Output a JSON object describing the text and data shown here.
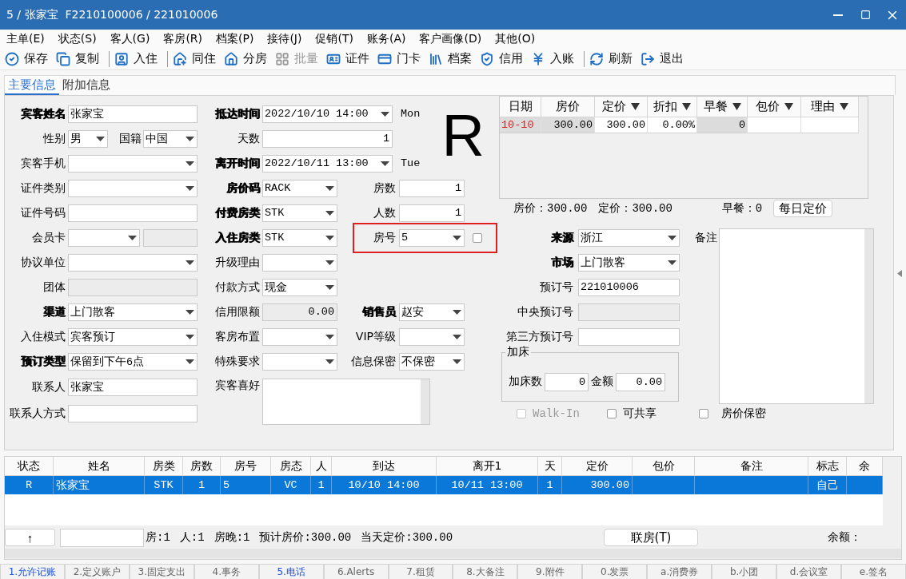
{
  "window": {
    "title": "5 / 张家宝  F2210100006 / 221010006"
  },
  "menu": [
    "主单(E)",
    "状态(S)",
    "客人(G)",
    "客房(R)",
    "档案(P)",
    "接待(J)",
    "促销(T)",
    "账务(A)",
    "客户画像(D)",
    "其他(O)"
  ],
  "toolbar": [
    {
      "label": "保存",
      "disabled": false,
      "separator_before": false
    },
    {
      "label": "复制",
      "disabled": false,
      "separator_before": false
    },
    {
      "label": "入住",
      "disabled": false,
      "separator_before": true
    },
    {
      "label": "同住",
      "disabled": false,
      "separator_before": true
    },
    {
      "label": "分房",
      "disabled": false,
      "separator_before": false
    },
    {
      "label": "批量",
      "disabled": true,
      "separator_before": false
    },
    {
      "label": "证件",
      "disabled": false,
      "separator_before": false
    },
    {
      "label": "门卡",
      "disabled": false,
      "separator_before": false
    },
    {
      "label": "档案",
      "disabled": false,
      "separator_before": false
    },
    {
      "label": "信用",
      "disabled": false,
      "separator_before": false
    },
    {
      "label": "入账",
      "disabled": false,
      "separator_before": false
    },
    {
      "label": "刷新",
      "disabled": false,
      "separator_before": true
    },
    {
      "label": "退出",
      "disabled": false,
      "separator_before": false
    }
  ],
  "tabs": [
    {
      "label": "主要信息",
      "selected": true
    },
    {
      "label": "附加信息",
      "selected": false
    }
  ],
  "status_letter": "R",
  "left_rows": [
    [
      {
        "label": "宾客姓名",
        "value": "张家宝",
        "kind": "text",
        "bold": true
      }
    ],
    [
      {
        "label": "性别",
        "value": "男",
        "kind": "combo",
        "bold": false
      },
      {
        "label": "国籍",
        "value": "中国",
        "kind": "combo",
        "bold": false
      }
    ],
    [
      {
        "label": "宾客手机",
        "kind": "combo",
        "bold": false
      }
    ],
    [
      {
        "label": "证件类别",
        "kind": "combo",
        "bold": false
      }
    ],
    [
      {
        "label": "证件号码",
        "kind": "text",
        "bold": false
      }
    ],
    [
      {
        "label": "会员卡",
        "kind": "combo",
        "bold": false
      },
      {
        "kind": "disabled"
      }
    ],
    [
      {
        "label": "协议单位",
        "kind": "combo",
        "bold": false
      }
    ],
    [
      {
        "label": "团体",
        "kind": "disabled",
        "bold": false
      }
    ],
    [
      {
        "label": "渠道",
        "value": "上门散客",
        "kind": "combo",
        "bold": true
      }
    ],
    [
      {
        "label": "入住模式",
        "value": "宾客预订",
        "kind": "combo",
        "bold": false
      }
    ],
    [
      {
        "label": "预订类型",
        "value": "保留到下午6点",
        "kind": "combo",
        "bold": true
      }
    ],
    [
      {
        "label": "联系人",
        "value": "张家宝",
        "kind": "text",
        "bold": false
      }
    ],
    [
      {
        "label": "联系人方式",
        "kind": "text",
        "bold": false
      }
    ]
  ],
  "middle_fields": [
    {
      "label": "抵达时间",
      "value": "2022/10/10 14:00",
      "kind": "date",
      "bold": true,
      "note": "Mon"
    },
    {
      "label": "天数",
      "value": "1",
      "kind": "number",
      "bold": false
    },
    {
      "label": "离开时间",
      "value": "2022/10/11 13:00",
      "kind": "date",
      "bold": true,
      "note": "Tue"
    },
    {
      "label": "房价码",
      "value": "RACK",
      "kind": "combo",
      "bold": true
    },
    {
      "label": "付费房类",
      "value": "STK",
      "kind": "combo",
      "bold": true
    },
    {
      "label": "入住房类",
      "value": "STK",
      "kind": "combo",
      "bold": true
    },
    {
      "label": "升级理由",
      "kind": "combo",
      "bold": false
    },
    {
      "label": "付款方式",
      "value": "现金",
      "kind": "combo",
      "bold": false
    },
    {
      "label": "信用限额",
      "value": "0.00",
      "kind": "disabled",
      "bold": false
    },
    {
      "label": "客房布置",
      "kind": "combo",
      "bold": false
    },
    {
      "label": "特殊要求",
      "kind": "combo",
      "bold": false
    },
    {
      "label": "宾客喜好",
      "kind": "memo",
      "bold": false
    }
  ],
  "side_fields": [
    {
      "label": "房数",
      "value": "1",
      "kind": "number",
      "bold": false,
      "highlighted": false
    },
    {
      "label": "人数",
      "value": "1",
      "kind": "number",
      "bold": false,
      "highlighted": false
    },
    {
      "label": "房号",
      "value": "5",
      "kind": "combo",
      "bold": false,
      "highlighted": true,
      "checked": false
    },
    {
      "label": "销售员",
      "value": "赵安",
      "kind": "combo",
      "bold": true,
      "highlighted": false
    },
    {
      "label": "VIP等级",
      "kind": "combo",
      "bold": false,
      "highlighted": false
    },
    {
      "label": "信息保密",
      "value": "不保密",
      "kind": "combo",
      "bold": false,
      "highlighted": false
    }
  ],
  "rate_table": {
    "columns": [
      {
        "label": "日期",
        "filter": false,
        "editable": false
      },
      {
        "label": "房价",
        "filter": false,
        "editable": false
      },
      {
        "label": "定价",
        "filter": true,
        "editable": true
      },
      {
        "label": "折扣",
        "filter": true,
        "editable": true
      },
      {
        "label": "早餐",
        "filter": true,
        "editable": false
      },
      {
        "label": "包价",
        "filter": true,
        "editable": true
      },
      {
        "label": "理由",
        "filter": true,
        "editable": true
      }
    ],
    "rows": [
      {
        "cells": [
          "10-10",
          "300.00",
          "300.00",
          "0.00%",
          "0"
        ]
      }
    ]
  },
  "rate_summary": {
    "items": [
      "房价：300.00",
      "定价：300.00",
      "早餐：0"
    ],
    "button": "每日定价"
  },
  "booking_fields": [
    {
      "label": "来源",
      "value": "浙江",
      "kind": "combo",
      "bold": true
    },
    {
      "label": "市场",
      "value": "上门散客",
      "kind": "combo",
      "bold": true
    },
    {
      "label": "预订号",
      "value": "221010006",
      "kind": "text",
      "bold": false
    },
    {
      "label": "中央预订号",
      "kind": "disabled",
      "bold": false
    },
    {
      "label": "第三方预订号",
      "kind": "text",
      "bold": false
    }
  ],
  "remark": {
    "label": "备注"
  },
  "extra_bed": {
    "title": "加床",
    "fields": [
      {
        "label": "加床数",
        "value": "0"
      },
      {
        "label": "金额",
        "value": "0.00"
      }
    ]
  },
  "options": [
    {
      "label": "Walk-In",
      "checked": false,
      "disabled": true
    },
    {
      "label": "可共享",
      "checked": false,
      "disabled": false
    },
    {
      "label": "房价保密",
      "checked": false,
      "disabled": false
    }
  ],
  "room_list": {
    "columns": [
      "状态",
      "姓名",
      "房类",
      "房数",
      "房号",
      "房态",
      "人",
      "到达",
      "离开1",
      "天",
      "定价",
      "包价",
      "备注",
      "标志",
      "余"
    ],
    "rows": [
      {
        "selected": true,
        "cells": [
          "R",
          "张家宝",
          "STK",
          "1",
          "5",
          "VC",
          "1",
          "10/10 14:00",
          "10/11 13:00",
          "1",
          "300.00",
          null,
          null,
          "自己",
          null
        ]
      }
    ]
  },
  "room_footer": {
    "up_button": "↑",
    "stats": [
      "房:1",
      "人:1",
      "房晚:1",
      "预计房价:300.00",
      "当天定价:300.00"
    ],
    "link_button": "联房(T)",
    "balance_label": "余额："
  },
  "bottom_tabs": [
    {
      "label": "1.允许记账",
      "active": true
    },
    {
      "label": "2.定义账户",
      "active": false
    },
    {
      "label": "3.固定支出",
      "active": false
    },
    {
      "label": "4.事务",
      "active": false
    },
    {
      "label": "5.电话",
      "active": true
    },
    {
      "label": "6.Alerts",
      "active": false
    },
    {
      "label": "7.租赁",
      "active": false
    },
    {
      "label": "8.大备注",
      "active": false
    },
    {
      "label": "9.附件",
      "active": false
    },
    {
      "label": "0.发票",
      "active": false
    },
    {
      "label": "a.消费券",
      "active": false
    },
    {
      "label": "b.小团",
      "active": false
    },
    {
      "label": "d.会议室",
      "active": false
    },
    {
      "label": "e.签名",
      "active": false
    }
  ]
}
